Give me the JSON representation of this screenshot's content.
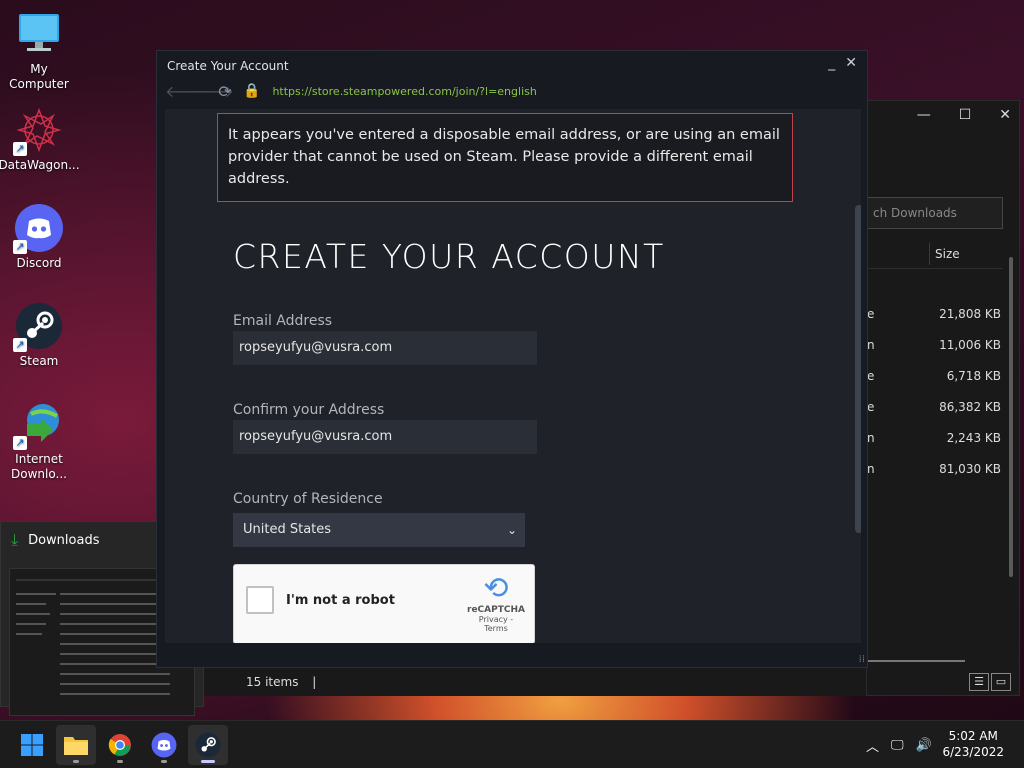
{
  "desktop": {
    "icons": [
      {
        "label": "My Computer",
        "icon": "monitor-icon"
      },
      {
        "label": "DataWagon...",
        "icon": "datawagon-icon"
      },
      {
        "label": "Discord",
        "icon": "discord-icon"
      },
      {
        "label": "Steam",
        "icon": "steam-icon"
      },
      {
        "label": "Internet Downlo...",
        "icon": "idm-icon"
      }
    ]
  },
  "explorer": {
    "search_placeholder": "ch Downloads",
    "column_size": "Size",
    "rows": [
      {
        "type": "e",
        "size": "21,808 KB"
      },
      {
        "type": "n",
        "size": "11,006 KB"
      },
      {
        "type": "e",
        "size": "6,718 KB"
      },
      {
        "type": "e",
        "size": "86,382 KB"
      },
      {
        "type": "n",
        "size": "2,243 KB"
      },
      {
        "type": "n",
        "size": "81,030 KB"
      }
    ],
    "status": "15 items"
  },
  "downloads_preview": {
    "title": "Downloads"
  },
  "steam": {
    "window_title": "Create Your Account",
    "url": "https://store.steampowered.com/join/?l=english",
    "error_message": "It appears you've entered a disposable email address, or are using an email provider that cannot be used on Steam. Please provide a different email address.",
    "heading": "CREATE YOUR ACCOUNT",
    "email_label": "Email Address",
    "email_value": "ropseyufyu@vusra.com",
    "confirm_label": "Confirm your Address",
    "confirm_value": "ropseyufyu@vusra.com",
    "country_label": "Country of Residence",
    "country_value": "United States",
    "captcha": {
      "text": "I'm not a robot",
      "brand": "reCAPTCHA",
      "links": "Privacy - Terms"
    }
  },
  "taskbar": {
    "time": "5:02 AM",
    "date": "6/23/2022"
  },
  "colors": {
    "steam_bg": "#171a21",
    "error_border": "#c0434a",
    "url_green": "#8bc34a"
  }
}
